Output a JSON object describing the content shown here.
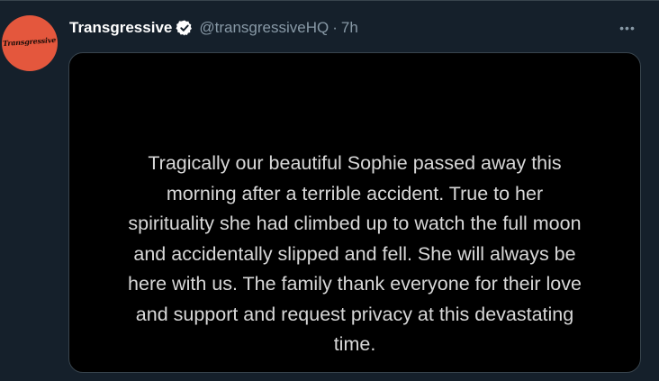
{
  "tweet": {
    "display_name": "Transgressive",
    "verified": true,
    "handle": "@transgressiveHQ",
    "separator": "·",
    "time": "7h",
    "more_label": "•••",
    "avatar": {
      "logo_text": "Transgressive"
    },
    "media": {
      "lines": [
        "Tragically our beautiful Sophie passed away this",
        "morning after a terrible accident. True to her",
        "spirituality she had climbed up to watch the full moon",
        "and accidentally slipped and fell. She will always be",
        "here with us. The family thank everyone for their love",
        "and support and request privacy at this devastating",
        "time."
      ]
    }
  },
  "colors": {
    "background": "#15202b",
    "avatar": "#e4573d",
    "secondary_text": "#8899a6",
    "media_background": "#000000"
  }
}
